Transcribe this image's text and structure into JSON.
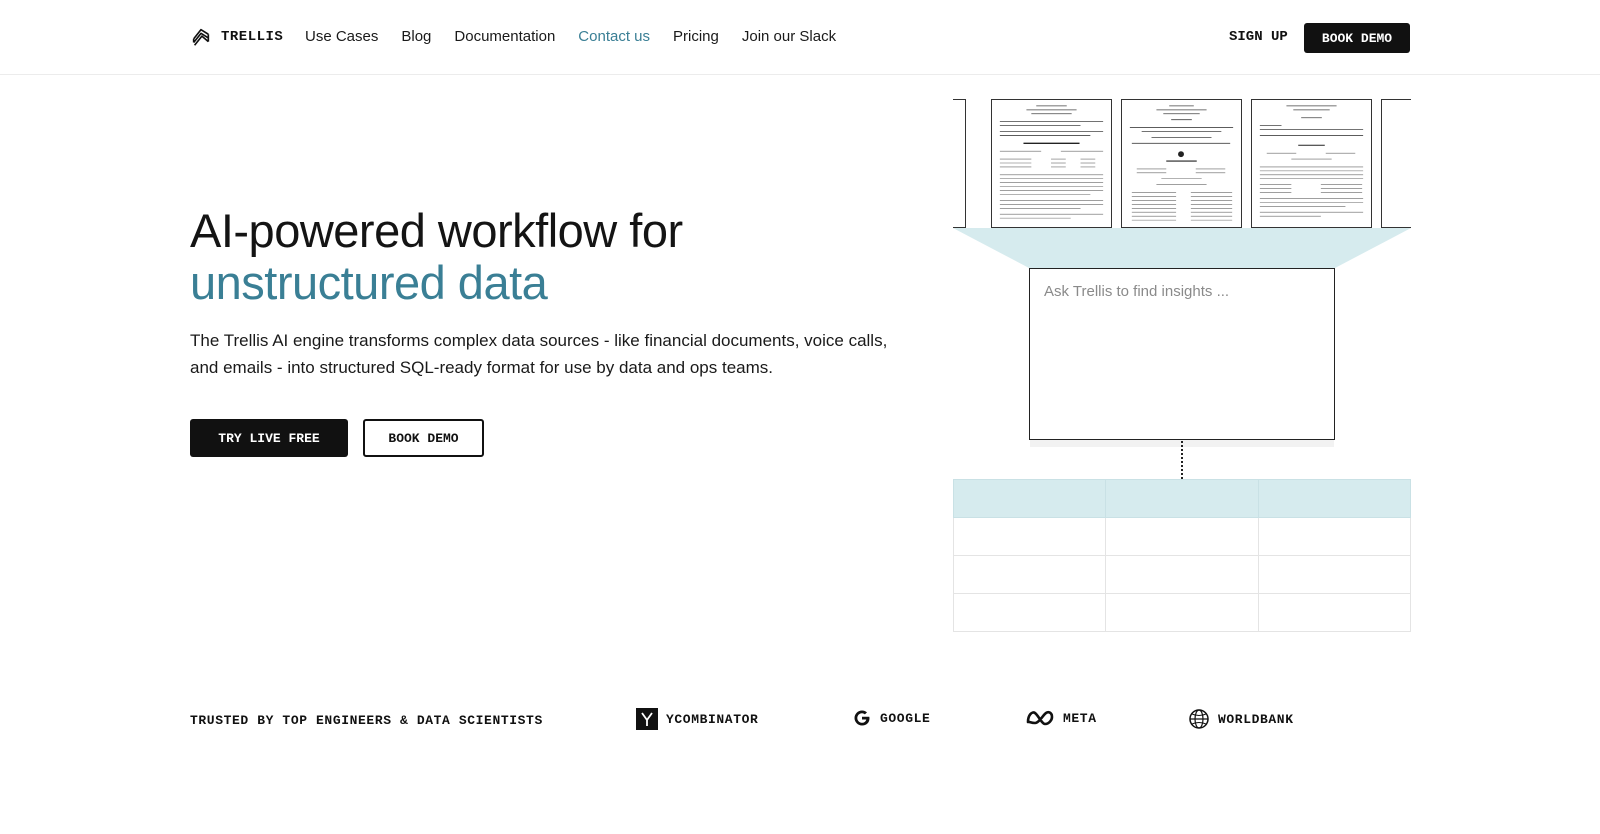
{
  "header": {
    "logo_text": "TRELLIS",
    "nav": [
      {
        "label": "Use Cases"
      },
      {
        "label": "Blog"
      },
      {
        "label": "Documentation"
      },
      {
        "label": "Contact us"
      },
      {
        "label": "Pricing"
      },
      {
        "label": "Join our Slack"
      }
    ],
    "signup_label": "SIGN UP",
    "book_demo_label": "BOOK DEMO"
  },
  "hero": {
    "title_line1": "AI-powered workflow for",
    "title_line2": "unstructured data",
    "description": "The Trellis AI engine transforms complex data sources - like financial documents, voice calls, and emails - into structured SQL-ready format for use by data and ops teams.",
    "try_label": "TRY LIVE FREE",
    "demo_label": "BOOK DEMO"
  },
  "illustration": {
    "ask_placeholder": "Ask Trellis to find insights ..."
  },
  "trusted": {
    "label": "TRUSTED BY TOP ENGINEERS & DATA SCIENTISTS",
    "brands": [
      {
        "name": "YCOMBINATOR",
        "icon": "ycombinator-icon"
      },
      {
        "name": "GOOGLE",
        "icon": "google-icon"
      },
      {
        "name": "META",
        "icon": "meta-icon"
      },
      {
        "name": "WORLDBANK",
        "icon": "worldbank-icon"
      }
    ]
  },
  "colors": {
    "accent": "#3a7f95",
    "table_header": "#d6ebee",
    "dark": "#111111"
  }
}
